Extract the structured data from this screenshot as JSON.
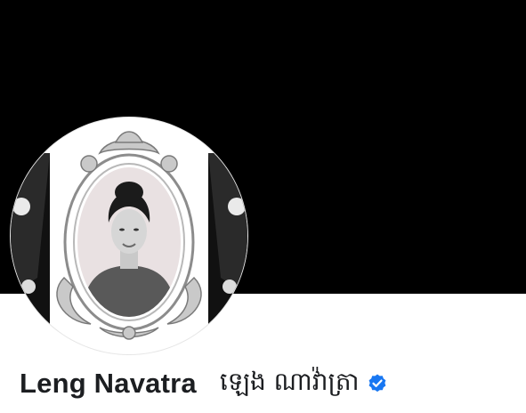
{
  "profile": {
    "name": "Leng Navatra",
    "alt_name": "ឡេង ណាវ៉ាត្រា",
    "verified": true
  },
  "colors": {
    "cover": "#000000",
    "verified_badge": "#1877f2",
    "name_text": "#1c1e21"
  },
  "icons": {
    "verified": "verified-badge-icon"
  }
}
